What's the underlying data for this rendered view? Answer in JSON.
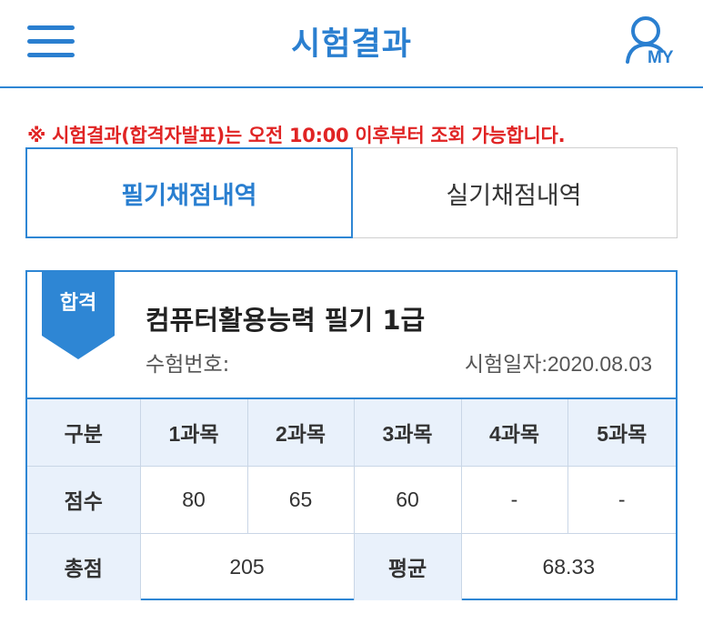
{
  "header": {
    "title": "시험결과",
    "my_label": "MY"
  },
  "notice": "※ 시험결과(합격자발표)는 오전 10:00 이후부터 조회 가능합니다.",
  "tabs": [
    {
      "label": "필기채점내역",
      "active": true
    },
    {
      "label": "실기채점내역",
      "active": false
    }
  ],
  "result": {
    "status": "합격",
    "exam_name": "컴퓨터활용능력 필기 1급",
    "exam_number_label": "수험번호:",
    "exam_date": "시험일자:2020.08.03",
    "table": {
      "headers": [
        "구분",
        "1과목",
        "2과목",
        "3과목",
        "4과목",
        "5과목"
      ],
      "score_label": "점수",
      "scores": [
        "80",
        "65",
        "60",
        "-",
        "-"
      ],
      "total_label": "총점",
      "total": "205",
      "average_label": "평균",
      "average": "68.33"
    }
  },
  "colors": {
    "accent": "#2a7fd0",
    "notice": "#e02424",
    "header_bg": "#e9f1fb"
  }
}
